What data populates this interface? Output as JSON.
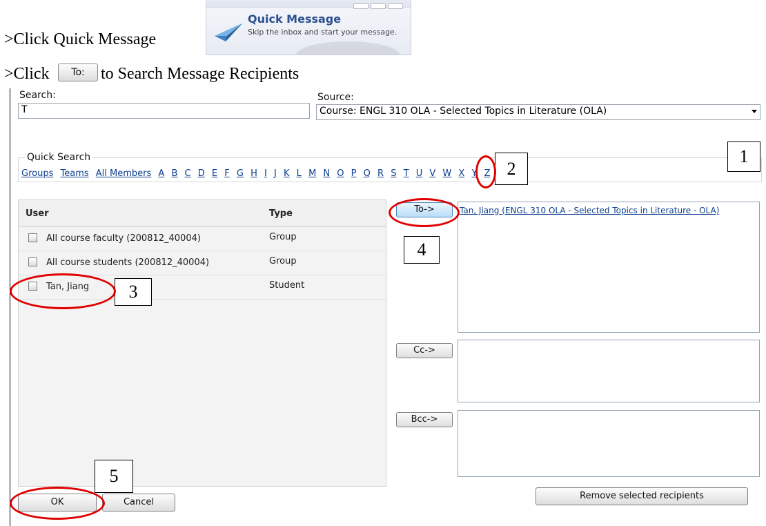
{
  "instructions": {
    "step1": ">Click Quick Message",
    "step2_prefix": ">Click",
    "step2_button": "To:",
    "step2_suffix": "to Search Message Recipients"
  },
  "quick_message": {
    "title": "Quick Message",
    "description": "Skip the inbox and start your message."
  },
  "search": {
    "label": "Search:",
    "value": "T"
  },
  "source": {
    "label": "Source:",
    "value": "Course: ENGL 310 OLA - Selected Topics in Literature (OLA)"
  },
  "quick_search": {
    "legend": "Quick Search",
    "links": [
      "Groups",
      "Teams",
      "All Members",
      "A",
      "B",
      "C",
      "D",
      "E",
      "F",
      "G",
      "H",
      "I",
      "J",
      "K",
      "L",
      "M",
      "N",
      "O",
      "P",
      "Q",
      "R",
      "S",
      "T",
      "U",
      "V",
      "W",
      "X",
      "Y",
      "Z"
    ]
  },
  "table": {
    "col_user": "User",
    "col_type": "Type",
    "rows": [
      {
        "user": "All course faculty (200812_40004)",
        "type": "Group"
      },
      {
        "user": "All course students (200812_40004)",
        "type": "Group"
      },
      {
        "user": "Tan, Jiang",
        "type": "Student"
      }
    ]
  },
  "buttons": {
    "to": "To->",
    "cc": "Cc->",
    "bcc": "Bcc->",
    "ok": "OK",
    "cancel": "Cancel",
    "remove": "Remove selected recipients"
  },
  "to_recipients": [
    "Tan, Jiang (ENGL 310 OLA - Selected Topics in Literature - OLA)"
  ],
  "annotations": [
    "1",
    "2",
    "3",
    "4",
    "5"
  ],
  "colors": {
    "annotation_ring": "#e00000",
    "link": "#0b3e8f"
  }
}
